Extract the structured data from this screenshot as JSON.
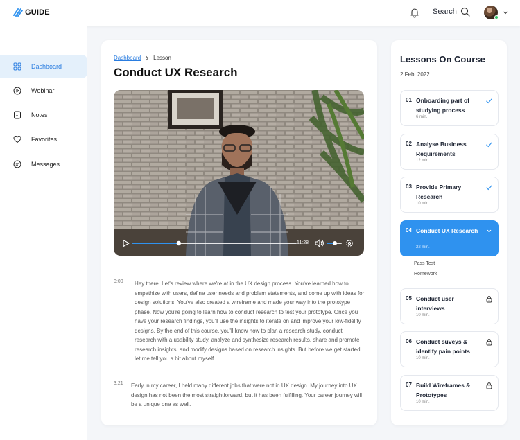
{
  "app": {
    "name": "GUIDE"
  },
  "header": {
    "search_label": "Search"
  },
  "sidebar": {
    "items": [
      {
        "label": "Dashboard",
        "icon": "grid-icon",
        "active": true
      },
      {
        "label": "Webinar",
        "icon": "play-circle-icon"
      },
      {
        "label": "Notes",
        "icon": "notes-icon"
      },
      {
        "label": "Favorites",
        "icon": "heart-icon"
      },
      {
        "label": "Messages",
        "icon": "messages-icon"
      }
    ]
  },
  "breadcrumb": {
    "link": "Dashboard",
    "current": "Lesson"
  },
  "lesson": {
    "title": "Conduct UX Research",
    "video": {
      "time": "11:28",
      "progress": 0.28,
      "volume": 0.55
    }
  },
  "transcript": [
    {
      "time": "0:00",
      "text": "Hey there. Let's review where we're at in the UX design process. You've learned how to empathize with users, define user needs and problem statements, and come up with ideas for design solutions. You've also created a wireframe and made your way into the prototype phase. Now you're going to learn how to conduct research to test your prototype. Once you have your research findings, you'll use the insights to iterate on and improve your low-fidelity designs. By the end of this course, you'll know how to plan a research study, conduct research with a usability study, analyze and synthesize research results, share and promote research insights, and modify designs based on research insights. But before we get started, let me tell you a bit about myself."
    },
    {
      "time": "3:21",
      "text": "Early in my career, I held many different jobs that were not in UX design. My journey into UX design has not been the most straightforward, but it has been fulfilling. Your career journey will be a unique one as well."
    }
  ],
  "course": {
    "title": "Lessons On Course",
    "date": "2 Feb, 2022",
    "lessons": [
      {
        "num": "01",
        "title": "Onboarding part of studying process",
        "duration": "6 min.",
        "status": "done"
      },
      {
        "num": "02",
        "title": "Analyse Business Requirements",
        "duration": "12 min.",
        "status": "done"
      },
      {
        "num": "03",
        "title": "Provide Primary Research",
        "duration": "10 min.",
        "status": "done"
      },
      {
        "num": "04",
        "title": "Conduct UX Research",
        "duration": "22 min.",
        "status": "active",
        "subitems": [
          "Pass Test",
          "Homework"
        ]
      },
      {
        "num": "05",
        "title": "Conduct user interviews",
        "duration": "10 min.",
        "status": "locked"
      },
      {
        "num": "06",
        "title": "Conduct suveys & identify pain points",
        "duration": "10 min.",
        "status": "locked"
      },
      {
        "num": "07",
        "title": "Build Wireframes & Prototypes",
        "duration": "10 min.",
        "status": "locked"
      }
    ]
  },
  "colors": {
    "accent": "#2f92ef",
    "link": "#2a7de0",
    "active_bg": "#e4f0fb",
    "online": "#37c36a"
  }
}
